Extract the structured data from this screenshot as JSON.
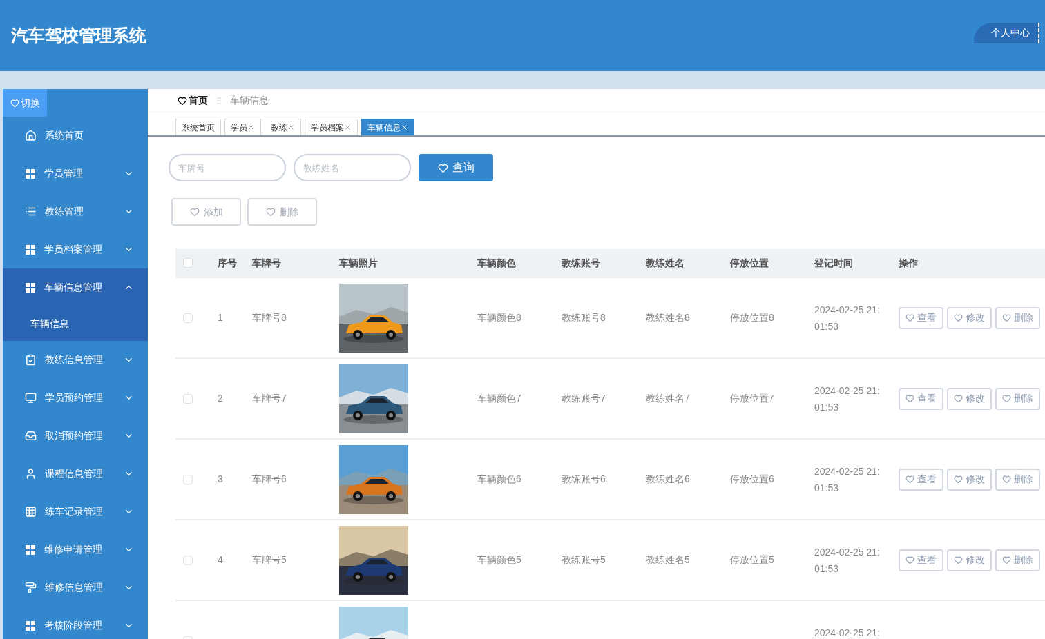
{
  "header": {
    "title": "汽车驾校管理系统",
    "user_menu": "个人中心"
  },
  "sidebar": {
    "toggle": "切换",
    "items": [
      {
        "label": "系统首页",
        "kind": "link"
      },
      {
        "label": "学员管理",
        "kind": "group",
        "expanded": false
      },
      {
        "label": "教练管理",
        "kind": "group",
        "expanded": false
      },
      {
        "label": "学员档案管理",
        "kind": "group",
        "expanded": false
      },
      {
        "label": "车辆信息管理",
        "kind": "group",
        "expanded": true,
        "children": [
          {
            "label": "车辆信息"
          }
        ]
      },
      {
        "label": "教练信息管理",
        "kind": "group",
        "expanded": false
      },
      {
        "label": "学员预约管理",
        "kind": "group",
        "expanded": false
      },
      {
        "label": "取消预约管理",
        "kind": "group",
        "expanded": false
      },
      {
        "label": "课程信息管理",
        "kind": "group",
        "expanded": false
      },
      {
        "label": "练车记录管理",
        "kind": "group",
        "expanded": false
      },
      {
        "label": "维修申请管理",
        "kind": "group",
        "expanded": false
      },
      {
        "label": "维修信息管理",
        "kind": "group",
        "expanded": false
      },
      {
        "label": "考核阶段管理",
        "kind": "group",
        "expanded": false
      }
    ]
  },
  "breadcrumb": [
    "首页",
    "车辆信息"
  ],
  "tabs": [
    {
      "label": "系统首页",
      "closable": false,
      "selected": false
    },
    {
      "label": "学员",
      "closable": true,
      "selected": false
    },
    {
      "label": "教练",
      "closable": true,
      "selected": false
    },
    {
      "label": "学员档案",
      "closable": true,
      "selected": false
    },
    {
      "label": "车辆信息",
      "closable": true,
      "selected": true
    }
  ],
  "search": {
    "fields": [
      {
        "placeholder": "车牌号"
      },
      {
        "placeholder": "教练姓名"
      }
    ],
    "button": "查询"
  },
  "actions": [
    "添加",
    "删除"
  ],
  "table": {
    "all_checked": false,
    "columns": [
      "序号",
      "车牌号",
      "车辆照片",
      "车辆颜色",
      "教练账号",
      "教练姓名",
      "停放位置",
      "登记时间",
      "操作"
    ],
    "rows": [
      {
        "checked": false,
        "index": "1",
        "plate": "车牌号8",
        "vehicle_color": "车辆颜色8",
        "account": "教练账号8",
        "coach": "教练姓名8",
        "location": "停放位置8",
        "time": "2024-02-25 21:01:53",
        "actions": [
          "查看",
          "修改",
          "删除"
        ]
      },
      {
        "checked": false,
        "index": "2",
        "plate": "车牌号7",
        "vehicle_color": "车辆颜色7",
        "account": "教练账号7",
        "coach": "教练姓名7",
        "location": "停放位置7",
        "time": "2024-02-25 21:01:53",
        "actions": [
          "查看",
          "修改",
          "删除"
        ]
      },
      {
        "checked": false,
        "index": "3",
        "plate": "车牌号6",
        "vehicle_color": "车辆颜色6",
        "account": "教练账号6",
        "coach": "教练姓名6",
        "location": "停放位置6",
        "time": "2024-02-25 21:01:53",
        "actions": [
          "查看",
          "修改",
          "删除"
        ]
      },
      {
        "checked": false,
        "index": "4",
        "plate": "车牌号5",
        "vehicle_color": "车辆颜色5",
        "account": "教练账号5",
        "coach": "教练姓名5",
        "location": "停放位置5",
        "time": "2024-02-25 21:01:53",
        "actions": [
          "查看",
          "修改",
          "删除"
        ]
      },
      {
        "checked": false,
        "time": "2024-02-25 21:"
      }
    ]
  }
}
